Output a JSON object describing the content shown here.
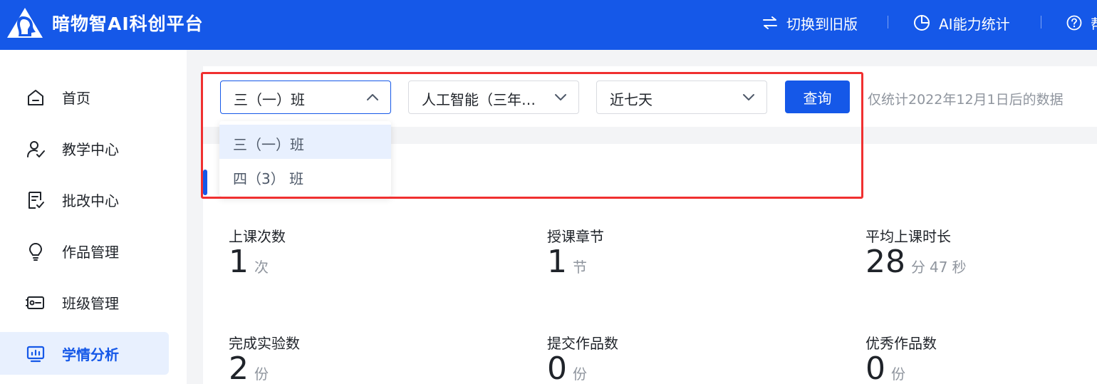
{
  "header": {
    "brand": "暗物智AI科创平台",
    "switch_label": "切换到旧版",
    "ai_stats_label": "AI能力统计",
    "help_label": "帮"
  },
  "sidebar": {
    "items": [
      {
        "label": "首页",
        "icon": "home-icon"
      },
      {
        "label": "教学中心",
        "icon": "teacher-icon"
      },
      {
        "label": "批改中心",
        "icon": "grading-icon"
      },
      {
        "label": "作品管理",
        "icon": "lightbulb-icon"
      },
      {
        "label": "班级管理",
        "icon": "class-card-icon"
      },
      {
        "label": "学情分析",
        "icon": "analytics-icon",
        "active": true
      }
    ]
  },
  "filters": {
    "class_select": "三（一）班",
    "course_select": "人工智能（三年…",
    "range_select": "近七天",
    "query_button": "查询",
    "hint": "仅统计2022年12月1日后的数据"
  },
  "class_dropdown": {
    "options": [
      "三（一）班",
      "四（3） 班"
    ],
    "selected_index": 0
  },
  "stats": {
    "lessons": {
      "label": "上课次数",
      "value": "1",
      "unit": "次"
    },
    "chapters": {
      "label": "授课章节",
      "value": "1",
      "unit": "节"
    },
    "avg_duration": {
      "label": "平均上课时长",
      "minutes": "28",
      "min_unit": "分",
      "seconds": "47",
      "sec_unit": "秒"
    },
    "experiments": {
      "label": "完成实验数",
      "value": "2",
      "unit": "份"
    },
    "submitted": {
      "label": "提交作品数",
      "value": "0",
      "unit": "份"
    },
    "excellent": {
      "label": "优秀作品数",
      "value": "0",
      "unit": "份"
    }
  },
  "colors": {
    "brand_blue": "#1558e8",
    "highlight_red": "#f03030",
    "active_bg": "#e8f0fe"
  }
}
